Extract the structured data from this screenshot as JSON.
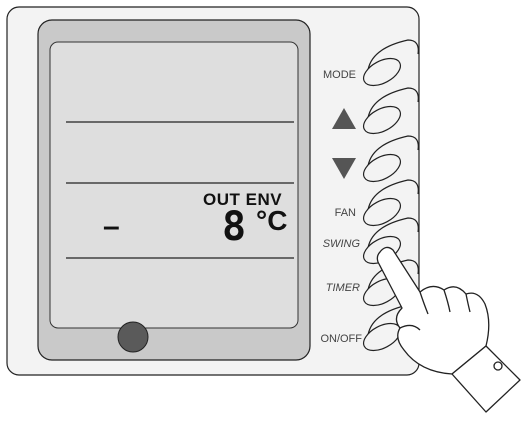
{
  "buttons": {
    "mode": "MODE",
    "up_icon": "triangle-up",
    "down_icon": "triangle-down",
    "fan": "FAN",
    "swing": "SWING",
    "timer": "TIMER",
    "onoff": "ON/OFF"
  },
  "display": {
    "label": "OUT ENV",
    "dash": "–",
    "temperature": "8",
    "unit": "°C"
  },
  "colors": {
    "panel": "#f3f3f3",
    "lcd": "#dedede",
    "lcd_frame": "#c9c9c9",
    "knob": "#5a5a5a",
    "outline": "#222222"
  }
}
